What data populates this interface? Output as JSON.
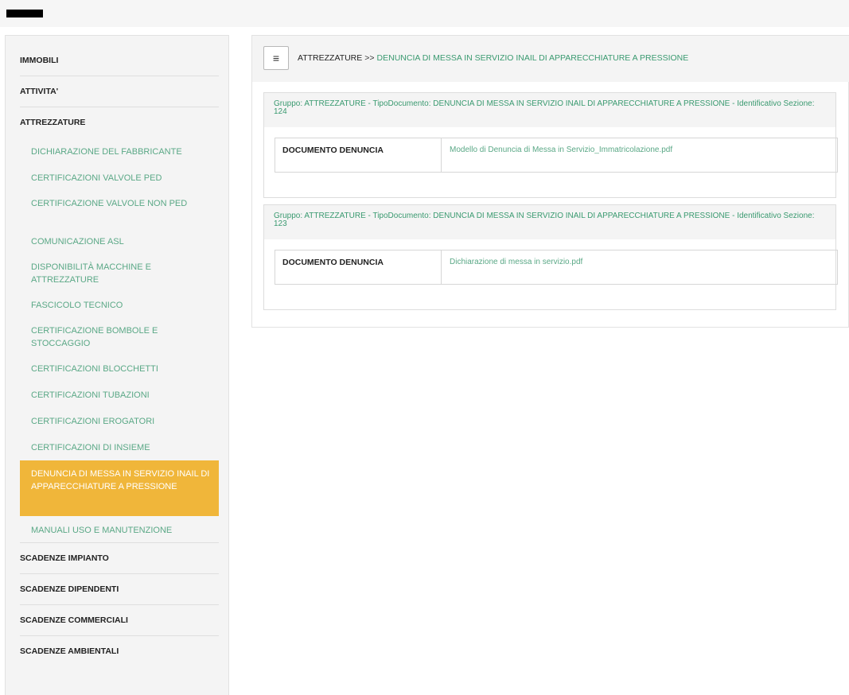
{
  "sidebar": {
    "menu_immobili": "IMMOBILI",
    "menu_attivita": "ATTIVITA'",
    "menu_attrezzature": "ATTREZZATURE",
    "sub_items": [
      "DICHIARAZIONE DEL FABBRICANTE",
      "CERTIFICAZIONI VALVOLE PED",
      "CERTIFICAZIONE VALVOLE NON PED",
      "COMUNICAZIONE ASL",
      "DISPONIBILITÀ MACCHINE E ATTREZZATURE",
      "FASCICOLO TECNICO",
      "CERTIFICAZIONE BOMBOLE E STOCCAGGIO",
      "CERTIFICAZIONI BLOCCHETTI",
      "CERTIFICAZIONI TUBAZIONI",
      "CERTIFICAZIONI EROGATORI",
      "CERTIFICAZIONI DI INSIEME",
      "DENUNCIA DI MESSA IN SERVIZIO INAIL DI APPARECCHIATURE A PRESSIONE",
      "MANUALI USO E MANUTENZIONE"
    ],
    "menu_scadenze_impianto": "SCADENZE IMPIANTO",
    "menu_scadenze_dipendenti": "SCADENZE DIPENDENTI",
    "menu_scadenze_commerciali": "SCADENZE COMMERCIALI",
    "menu_scadenze_ambientali": "SCADENZE AMBIENTALI",
    "active_color": "#f0b63a"
  },
  "header": {
    "menu_icon": "≡",
    "crumb_parent": "ATTREZZATURE",
    "crumb_separator": ">>",
    "crumb_current": "DENUNCIA DI MESSA IN SERVIZIO INAIL DI APPARECCHIATURE A PRESSIONE"
  },
  "panels": [
    {
      "title": "Gruppo: ATTREZZATURE - TipoDocumento: DENUNCIA DI MESSA IN SERVIZIO INAIL DI APPARECCHIATURE A PRESSIONE - Identificativo Sezione: 124",
      "label": "DOCUMENTO DENUNCIA",
      "file": "Modello di Denuncia di Messa in Servizio_Immatricolazione.pdf"
    },
    {
      "title": "Gruppo: ATTREZZATURE - TipoDocumento: DENUNCIA DI MESSA IN SERVIZIO INAIL DI APPARECCHIATURE A PRESSIONE - Identificativo Sezione: 123",
      "label": "DOCUMENTO DENUNCIA",
      "file": "Dichiarazione di messa in servizio.pdf"
    }
  ],
  "accent_color": "#3a9a70"
}
